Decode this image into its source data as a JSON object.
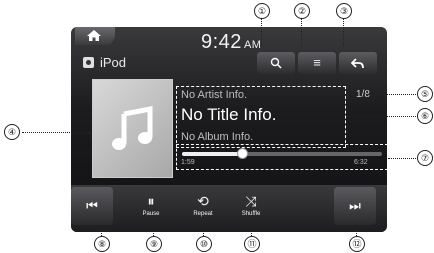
{
  "status_bar": {
    "time": "9:42",
    "ampm": "AM",
    "source_label": "iPod"
  },
  "top_buttons": {
    "search_glyph": "🔍",
    "menu_glyph": "≡",
    "back_glyph": "↶"
  },
  "track": {
    "artist": "No Artist Info.",
    "title": "No Title Info.",
    "album": "No Album Info.",
    "count": "1/8",
    "elapsed": "1:59",
    "total": "6:32",
    "progress": 0.3
  },
  "controls": {
    "prev_glyph": "⏮",
    "pause_glyph": "⏸",
    "pause_label": "Pause",
    "repeat_glyph": "⟲",
    "repeat_label": "Repeat",
    "shuffle_glyph": "⤨",
    "shuffle_label": "Shuffle",
    "next_glyph": "⏭"
  },
  "callouts": {
    "n1": "①",
    "n2": "②",
    "n3": "③",
    "n4": "④",
    "n5": "⑤",
    "n6": "⑥",
    "n7": "⑦",
    "n8": "⑧",
    "n9": "⑨",
    "n10": "⑩",
    "n11": "⑪",
    "n12": "⑫"
  }
}
